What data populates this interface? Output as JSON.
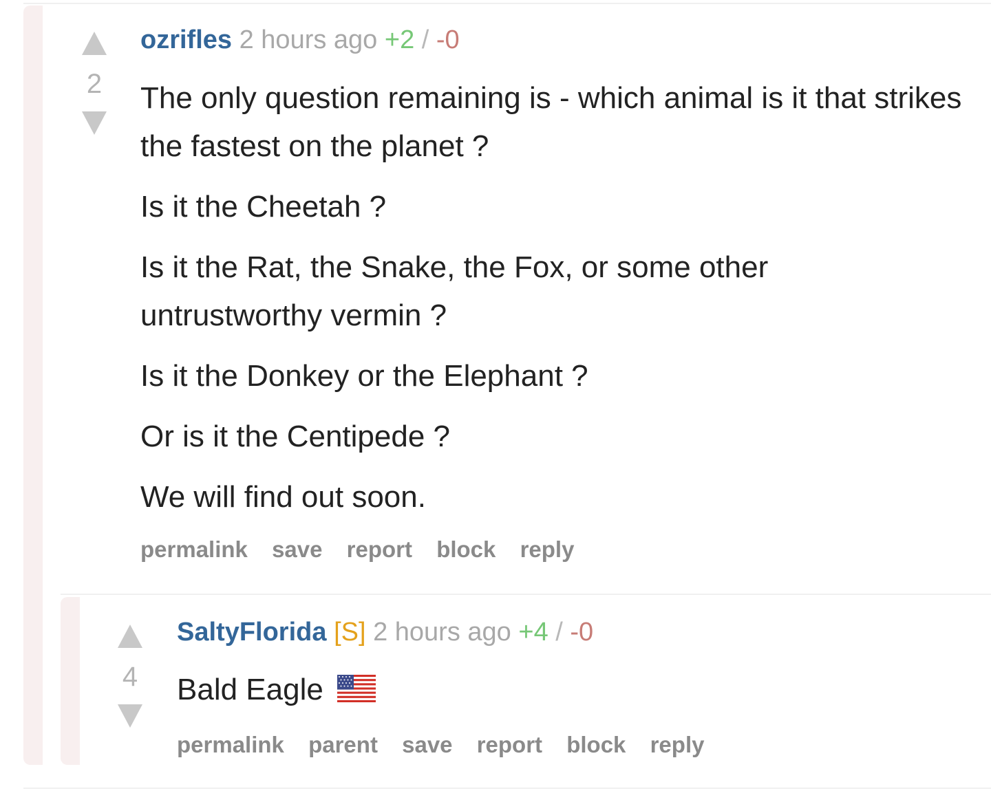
{
  "comment_parent": {
    "score": "2",
    "author": "ozrifles",
    "time": "2 hours ago",
    "upvotes": "+2",
    "separator": "/",
    "downvotes": "-0",
    "body": [
      "The only question remaining is - which animal is it that strikes the fastest on the planet ?",
      "Is it the Cheetah ?",
      "Is it the Rat, the Snake, the Fox, or some other untrustworthy vermin ?",
      "Is it the Donkey or the Elephant ?",
      "Or is it the Centipede ?",
      "We will find out soon."
    ],
    "actions": {
      "permalink": "permalink",
      "save": "save",
      "report": "report",
      "block": "block",
      "reply": "reply"
    }
  },
  "comment_reply": {
    "score": "4",
    "author": "SaltyFlorida",
    "flair": "[S]",
    "time": "2 hours ago",
    "upvotes": "+4",
    "separator": "/",
    "downvotes": "-0",
    "body": "Bald Eagle",
    "emoji": "flag-usa-icon",
    "actions": {
      "permalink": "permalink",
      "parent": "parent",
      "save": "save",
      "report": "report",
      "block": "block",
      "reply": "reply"
    }
  },
  "colors": {
    "author": "#336699",
    "submitter_flair": "#e4a11b",
    "upvotes": "#76c776",
    "downvotes": "#c77c76",
    "thread_bar": "#f8efef"
  }
}
